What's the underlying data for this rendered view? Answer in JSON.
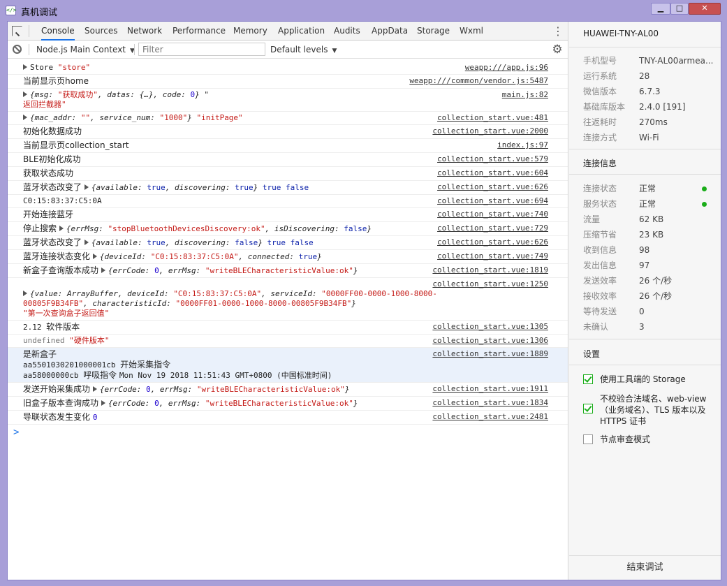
{
  "window": {
    "title": "真机调试",
    "icon": "devtools-icon",
    "controls": {
      "minimize": "▁",
      "maximize": "□",
      "close": "✕"
    }
  },
  "tabs": [
    "Console",
    "Sources",
    "Network",
    "Performance",
    "Memory",
    "Application",
    "Audits",
    "AppData",
    "Storage",
    "Wxml"
  ],
  "active_tab": "Console",
  "toolbar": {
    "context": "Node.js Main Context",
    "filter_placeholder": "Filter",
    "levels": "Default levels"
  },
  "log": [
    {
      "parts": [
        {
          "t": "tri"
        },
        {
          "t": "plain",
          "v": "Store "
        },
        {
          "t": "str",
          "v": "\"store\""
        }
      ],
      "src": "weapp:///app.js:96"
    },
    {
      "parts": [
        {
          "t": "cn",
          "v": "当前显示页home"
        }
      ],
      "src": "weapp:///common/vendor.js:5487"
    },
    {
      "parts": [
        {
          "t": "tri"
        },
        {
          "t": "obj",
          "v": "{msg: "
        },
        {
          "t": "str",
          "v": "\"获取成功\""
        },
        {
          "t": "obj",
          "v": ", datas: {…}, code: "
        },
        {
          "t": "num",
          "v": "0"
        },
        {
          "t": "obj",
          "v": "} "
        },
        {
          "t": "plain",
          "v": "\""
        },
        {
          "t": "br"
        },
        {
          "t": "str",
          "v": "返回拦截器\""
        }
      ],
      "src": "main.js:82",
      "nopad": true
    },
    {
      "parts": [
        {
          "t": "tri"
        },
        {
          "t": "obj",
          "v": "{mac_addr: "
        },
        {
          "t": "str",
          "v": "\"\""
        },
        {
          "t": "obj",
          "v": ", service_num: "
        },
        {
          "t": "str",
          "v": "\"1000\""
        },
        {
          "t": "obj",
          "v": "} "
        },
        {
          "t": "str",
          "v": "\"initPage\""
        }
      ],
      "src": "collection_start.vue:481"
    },
    {
      "parts": [
        {
          "t": "cn",
          "v": "初始化数据成功"
        }
      ],
      "src": "collection_start.vue:2000"
    },
    {
      "parts": [
        {
          "t": "cn",
          "v": "当前显示页collection_start"
        }
      ],
      "src": "index.js:97"
    },
    {
      "parts": [
        {
          "t": "cn",
          "v": "BLE初始化成功"
        }
      ],
      "src": "collection_start.vue:579"
    },
    {
      "parts": [
        {
          "t": "cn",
          "v": "获取状态成功"
        }
      ],
      "src": "collection_start.vue:604"
    },
    {
      "parts": [
        {
          "t": "cn",
          "v": "蓝牙状态改变了 "
        },
        {
          "t": "tri"
        },
        {
          "t": "obj",
          "v": "{available: "
        },
        {
          "t": "kw",
          "v": "true"
        },
        {
          "t": "obj",
          "v": ", discovering: "
        },
        {
          "t": "kw",
          "v": "true"
        },
        {
          "t": "obj",
          "v": "} "
        },
        {
          "t": "kw",
          "v": "true false"
        }
      ],
      "src": "collection_start.vue:626"
    },
    {
      "parts": [
        {
          "t": "plain",
          "v": "C0:15:83:37:C5:0A"
        }
      ],
      "src": "collection_start.vue:694"
    },
    {
      "parts": [
        {
          "t": "cn",
          "v": "开始连接蓝牙"
        }
      ],
      "src": "collection_start.vue:740"
    },
    {
      "parts": [
        {
          "t": "cn",
          "v": "停止搜索 "
        },
        {
          "t": "tri"
        },
        {
          "t": "obj",
          "v": "{errMsg: "
        },
        {
          "t": "str",
          "v": "\"stopBluetoothDevicesDiscovery:ok\""
        },
        {
          "t": "obj",
          "v": ", isDiscovering: "
        },
        {
          "t": "kw",
          "v": "false"
        },
        {
          "t": "obj",
          "v": "}"
        }
      ],
      "src": "collection_start.vue:729"
    },
    {
      "parts": [
        {
          "t": "cn",
          "v": "蓝牙状态改变了 "
        },
        {
          "t": "tri"
        },
        {
          "t": "obj",
          "v": "{available: "
        },
        {
          "t": "kw",
          "v": "true"
        },
        {
          "t": "obj",
          "v": ", discovering: "
        },
        {
          "t": "kw",
          "v": "false"
        },
        {
          "t": "obj",
          "v": "} "
        },
        {
          "t": "kw",
          "v": "true false"
        }
      ],
      "src": "collection_start.vue:626"
    },
    {
      "parts": [
        {
          "t": "cn",
          "v": "蓝牙连接状态变化 "
        },
        {
          "t": "tri"
        },
        {
          "t": "obj",
          "v": "{deviceId: "
        },
        {
          "t": "str",
          "v": "\"C0:15:83:37:C5:0A\""
        },
        {
          "t": "obj",
          "v": ", connected: "
        },
        {
          "t": "kw",
          "v": "true"
        },
        {
          "t": "obj",
          "v": "}"
        }
      ],
      "src": "collection_start.vue:749"
    },
    {
      "parts": [
        {
          "t": "cn",
          "v": "新盒子查询版本成功 "
        },
        {
          "t": "tri"
        },
        {
          "t": "obj",
          "v": "{errCode: "
        },
        {
          "t": "num",
          "v": "0"
        },
        {
          "t": "obj",
          "v": ", errMsg: "
        },
        {
          "t": "str",
          "v": "\"writeBLECharacteristicValue:ok\""
        },
        {
          "t": "obj",
          "v": "}"
        }
      ],
      "src": "collection_start.vue:1819"
    },
    {
      "parts": [
        {
          "t": "br"
        },
        {
          "t": "tri"
        },
        {
          "t": "obj",
          "v": "{value: ArrayBuffer, deviceId: "
        },
        {
          "t": "str",
          "v": "\"C0:15:83:37:C5:0A\""
        },
        {
          "t": "obj",
          "v": ", serviceId: "
        },
        {
          "t": "str",
          "v": "\"0000FF00-0000-1000-8000-"
        },
        {
          "t": "br"
        },
        {
          "t": "str",
          "v": "   00805F9B34FB\""
        },
        {
          "t": "obj",
          "v": ", characteristicId: "
        },
        {
          "t": "str",
          "v": "\"0000FF01-0000-1000-8000-00805F9B34FB\""
        },
        {
          "t": "obj",
          "v": "}"
        },
        {
          "t": "br"
        },
        {
          "t": "str",
          "v": "\"第一次查询盒子返回值\""
        }
      ],
      "src": "collection_start.vue:1250",
      "nopad": true
    },
    {
      "parts": [
        {
          "t": "plain",
          "v": "2.12 "
        },
        {
          "t": "cn",
          "v": "软件版本"
        }
      ],
      "src": "collection_start.vue:1305"
    },
    {
      "parts": [
        {
          "t": "gray",
          "v": "undefined "
        },
        {
          "t": "str",
          "v": "\"硬件版本\""
        }
      ],
      "src": "collection_start.vue:1306"
    },
    {
      "parts": [
        {
          "t": "cn",
          "v": "是新盒子"
        },
        {
          "t": "br"
        },
        {
          "t": "plain",
          "v": " aa5501030201000001cb "
        },
        {
          "t": "cn",
          "v": "开始采集指令"
        },
        {
          "t": "br"
        },
        {
          "t": "plain",
          "v": " aa58000000cb "
        },
        {
          "t": "cn",
          "v": "呼吸指令 "
        },
        {
          "t": "plain",
          "v": "Mon Nov 19 2018 11:51:43 GMT+0800 (中国标准时间)"
        }
      ],
      "src": "collection_start.vue:1889",
      "hl": true
    },
    {
      "parts": [
        {
          "t": "cn",
          "v": "发送开始采集成功 "
        },
        {
          "t": "tri"
        },
        {
          "t": "obj",
          "v": "{errCode: "
        },
        {
          "t": "num",
          "v": "0"
        },
        {
          "t": "obj",
          "v": ", errMsg: "
        },
        {
          "t": "str",
          "v": "\"writeBLECharacteristicValue:ok\""
        },
        {
          "t": "obj",
          "v": "}"
        }
      ],
      "src": "collection_start.vue:1911"
    },
    {
      "parts": [
        {
          "t": "cn",
          "v": "旧盒子版本查询成功 "
        },
        {
          "t": "tri"
        },
        {
          "t": "obj",
          "v": "{errCode: "
        },
        {
          "t": "num",
          "v": "0"
        },
        {
          "t": "obj",
          "v": ", errMsg: "
        },
        {
          "t": "str",
          "v": "\"writeBLECharacteristicValue:ok\""
        },
        {
          "t": "obj",
          "v": "}"
        }
      ],
      "src": "collection_start.vue:1834"
    },
    {
      "parts": [
        {
          "t": "cn",
          "v": "导联状态发生变化 "
        },
        {
          "t": "num",
          "v": "0"
        }
      ],
      "src": "collection_start.vue:2481"
    }
  ],
  "prompt": ">",
  "side": {
    "device": "HUAWEI-TNY-AL00",
    "info": [
      {
        "k": "手机型号",
        "v": "TNY-AL00armea..."
      },
      {
        "k": "运行系统",
        "v": "28"
      },
      {
        "k": "微信版本",
        "v": "6.7.3"
      },
      {
        "k": "基础库版本",
        "v": "2.4.0 [191]"
      },
      {
        "k": "往返耗时",
        "v": "270ms"
      },
      {
        "k": "连接方式",
        "v": "Wi-Fi"
      }
    ],
    "conn_title": "连接信息",
    "conn": [
      {
        "k": "连接状态",
        "v": "正常",
        "dot": true
      },
      {
        "k": "服务状态",
        "v": "正常",
        "dot": true
      },
      {
        "k": "流量",
        "v": "62 KB"
      },
      {
        "k": "压缩节省",
        "v": "23 KB"
      },
      {
        "k": "收到信息",
        "v": "98"
      },
      {
        "k": "发出信息",
        "v": "97"
      },
      {
        "k": "发送效率",
        "v": "26 个/秒"
      },
      {
        "k": "接收效率",
        "v": "26 个/秒"
      },
      {
        "k": "等待发送",
        "v": "0"
      },
      {
        "k": "未确认",
        "v": "3"
      }
    ],
    "settings_title": "设置",
    "settings": [
      {
        "label": "使用工具端的 Storage",
        "checked": true
      },
      {
        "label": "不校验合法域名、web-view（业务域名）、TLS 版本以及 HTTPS 证书",
        "checked": true
      },
      {
        "label": "节点审查模式",
        "checked": false
      }
    ],
    "end_button": "结束调试"
  },
  "colors": {
    "accent": "#1a73e8",
    "titlebar": "#a89fd8",
    "string": "#c41a16",
    "number": "#1c00cf",
    "ok": "#1aad19"
  }
}
